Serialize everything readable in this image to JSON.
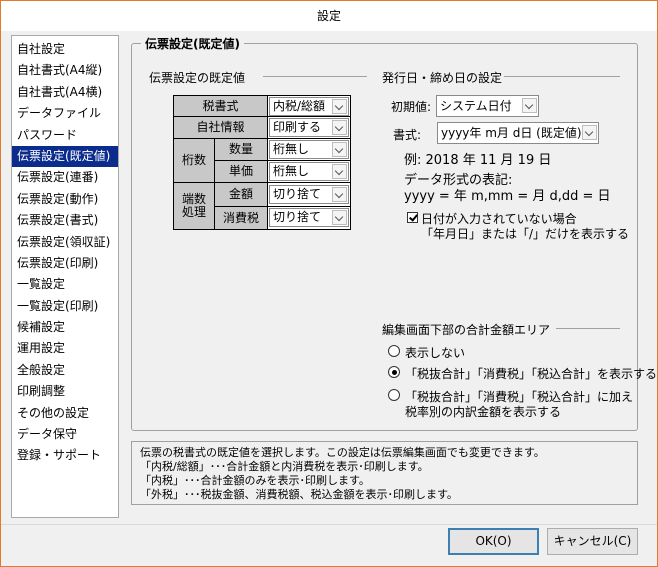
{
  "window": {
    "title": "設定"
  },
  "nav": {
    "items": [
      "自社設定",
      "自社書式(A4縦)",
      "自社書式(A4横)",
      "データファイル",
      "パスワード",
      "伝票設定(既定値)",
      "伝票設定(連番)",
      "伝票設定(動作)",
      "伝票設定(書式)",
      "伝票設定(領収証)",
      "伝票設定(印刷)",
      "一覧設定",
      "一覧設定(印刷)",
      "候補設定",
      "運用設定",
      "全般設定",
      "印刷調整",
      "その他の設定",
      "データ保守",
      "登録・サポート"
    ],
    "selected_index": 5
  },
  "group": {
    "title": "伝票設定(既定値)"
  },
  "defaults": {
    "section_title": "伝票設定の既定値",
    "tax_format_label": "税書式",
    "tax_format_value": "内税/総額",
    "company_info_label": "自社情報",
    "company_info_value": "印刷する",
    "digits_label": "桁数",
    "quantity_label": "数量",
    "quantity_value": "桁無し",
    "unit_price_label": "単価",
    "unit_price_value": "桁無し",
    "rounding_label": "端数処理",
    "amount_label": "金額",
    "amount_value": "切り捨て",
    "consumption_tax_label": "消費税",
    "consumption_tax_value": "切り捨て"
  },
  "dates": {
    "section_title": "発行日・締め日の設定",
    "initial_label": "初期値:",
    "initial_value": "システム日付",
    "format_label": "書式:",
    "format_value": "yyyy年 m月 d日 (既定値)",
    "example": "例: 2018 年 11 月 19 日",
    "notation_title": "データ形式の表記:",
    "notation_text": "yyyy = 年 m,mm = 月 d,dd = 日",
    "checkbox_line1": "日付が入力されていない場合",
    "checkbox_line2": "「年月日」または「/」だけを表示する",
    "checkbox_checked": true
  },
  "totals": {
    "section_title": "編集画面下部の合計金額エリア",
    "options": [
      {
        "line1": "表示しない",
        "line2": ""
      },
      {
        "line1": "「税抜合計」「消費税」「税込合計」を表示する",
        "line2": ""
      },
      {
        "line1": "「税抜合計」「消費税」「税込合計」に加え",
        "line2": "税率別の内訳金額を表示する"
      }
    ],
    "selected_index": 1
  },
  "description": {
    "lines": [
      "伝票の税書式の既定値を選択します。この設定は伝票編集画面でも変更できます。",
      "「内税/総額」･･･合計金額と内消費税を表示･印刷します。",
      "「内税」･･･合計金額のみを表示･印刷します。",
      "「外税」･･･税抜金額、消費税額、税込金額を表示･印刷します。"
    ]
  },
  "buttons": {
    "ok": "OK(O)",
    "cancel": "キャンセル(C)"
  }
}
